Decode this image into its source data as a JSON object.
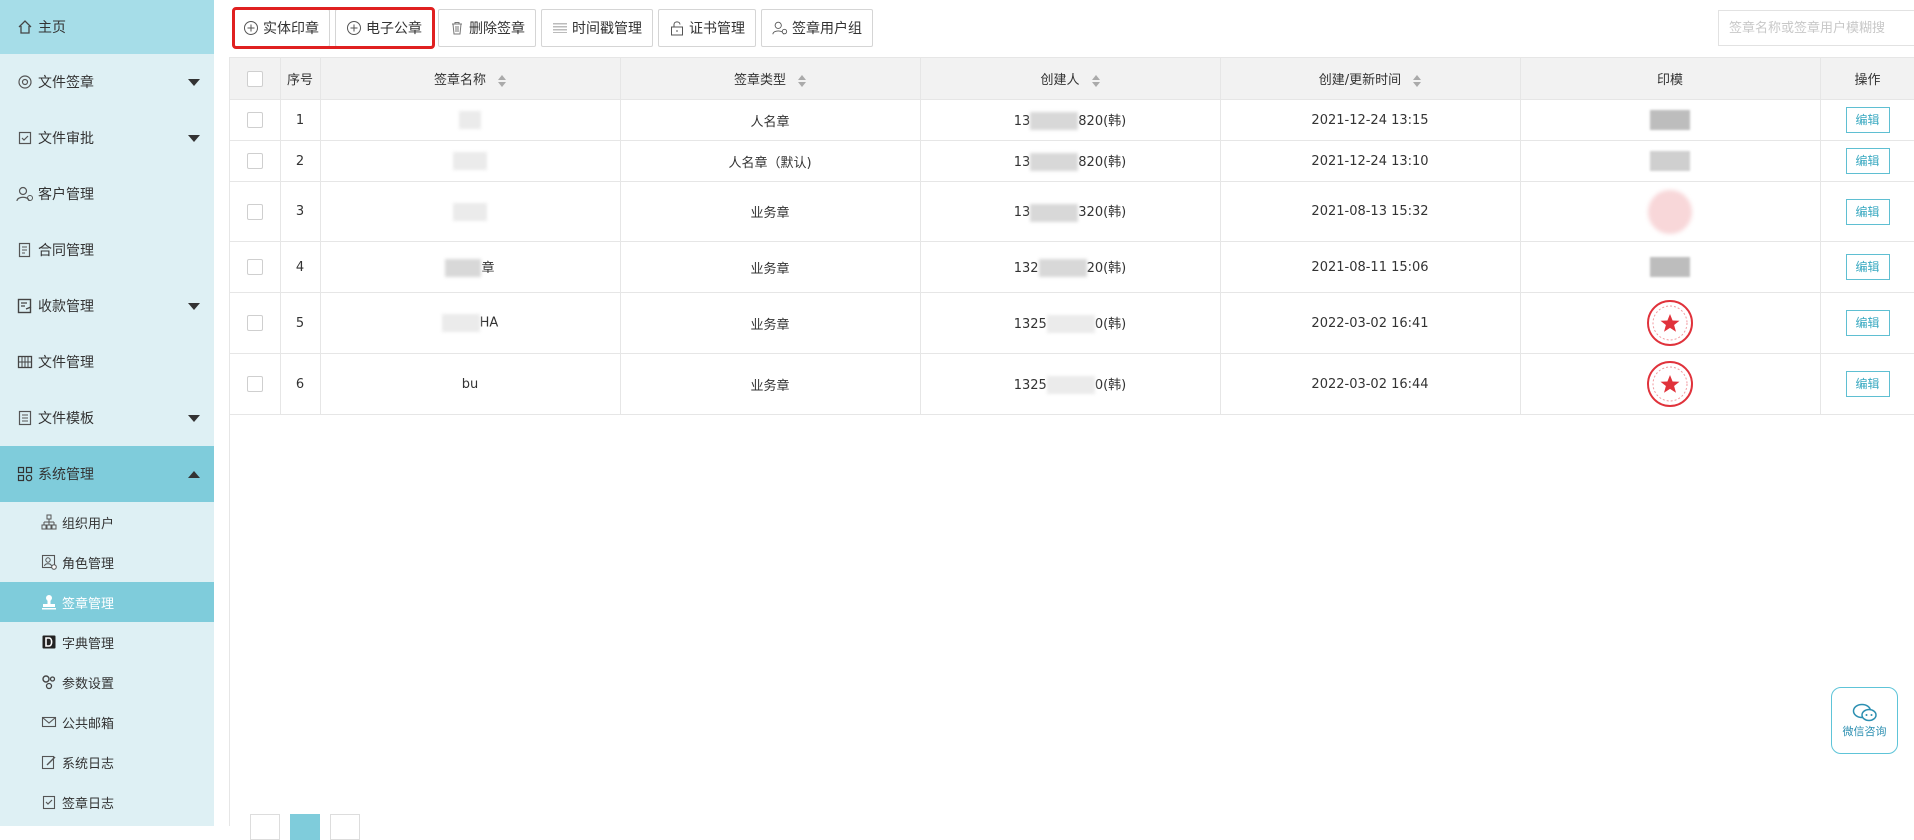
{
  "sidebar": {
    "home": "主页",
    "items": [
      {
        "label": "文件签章",
        "icon": "stamp-icon",
        "caret": "down"
      },
      {
        "label": "文件审批",
        "icon": "approve-icon",
        "caret": "down"
      },
      {
        "label": "客户管理",
        "icon": "customer-icon",
        "caret": ""
      },
      {
        "label": "合同管理",
        "icon": "contract-icon",
        "caret": ""
      },
      {
        "label": "收款管理",
        "icon": "payment-icon",
        "caret": "down"
      },
      {
        "label": "文件管理",
        "icon": "file-grid-icon",
        "caret": ""
      },
      {
        "label": "文件模板",
        "icon": "template-icon",
        "caret": "down"
      },
      {
        "label": "系统管理",
        "icon": "system-icon",
        "caret": "up"
      }
    ],
    "sub_items": [
      {
        "label": "组织用户",
        "icon": "org-icon"
      },
      {
        "label": "角色管理",
        "icon": "role-icon"
      },
      {
        "label": "签章管理",
        "icon": "seal-icon"
      },
      {
        "label": "字典管理",
        "icon": "dictionary-icon"
      },
      {
        "label": "参数设置",
        "icon": "settings-icon"
      },
      {
        "label": "公共邮箱",
        "icon": "mail-icon"
      },
      {
        "label": "系统日志",
        "icon": "log-icon"
      },
      {
        "label": "签章日志",
        "icon": "seal-log-icon"
      }
    ],
    "active_sub": "签章管理"
  },
  "toolbar": {
    "physical_seal": "实体印章",
    "electronic_seal": "电子公章",
    "delete_seal": "删除签章",
    "timestamp": "时间戳管理",
    "certificate": "证书管理",
    "seal_user_group": "签章用户组"
  },
  "search": {
    "placeholder": "签章名称或签章用户模糊搜"
  },
  "table": {
    "headers": {
      "index": "序号",
      "name": "签章名称",
      "type": "签章类型",
      "creator": "创建人",
      "time": "创建/更新时间",
      "seal": "印模",
      "action": "操作"
    },
    "rows": [
      {
        "index": "1",
        "name": "",
        "type": "人名章",
        "creator_prefix": "13",
        "creator_suffix": "820(韩)",
        "time": "2021-12-24 13:15",
        "seal": "gray",
        "action": "编辑"
      },
      {
        "index": "2",
        "name": "",
        "type": "人名章（默认)",
        "creator_prefix": "13",
        "creator_suffix": "820(韩)",
        "time": "2021-12-24 13:10",
        "seal": "gray",
        "action": "编辑"
      },
      {
        "index": "3",
        "name": "",
        "type": "业务章",
        "creator_prefix": "13",
        "creator_suffix": "320(韩)",
        "time": "2021-08-13 15:32",
        "seal": "red-blur",
        "action": "编辑"
      },
      {
        "index": "4",
        "name": "章",
        "type": "业务章",
        "creator_prefix": "132",
        "creator_suffix": "20(韩)",
        "time": "2021-08-11 15:06",
        "seal": "gray",
        "action": "编辑"
      },
      {
        "index": "5",
        "name": "HA",
        "type": "业务章",
        "creator_prefix": "1325",
        "creator_suffix": "0(韩)",
        "time": "2022-03-02 16:41",
        "seal": "red",
        "action": "编辑"
      },
      {
        "index": "6",
        "name": "bu",
        "type": "业务章",
        "creator_prefix": "1325",
        "creator_suffix": "0(韩)",
        "time": "2022-03-02 16:44",
        "seal": "red",
        "action": "编辑"
      }
    ]
  },
  "wechat": {
    "label": "微信咨询"
  },
  "colors": {
    "sidebar_bg": "#def0f4",
    "sidebar_active": "#7fccdb",
    "accent": "#3aa9c1",
    "highlight": "#e02020",
    "seal_red": "#e0323b"
  }
}
